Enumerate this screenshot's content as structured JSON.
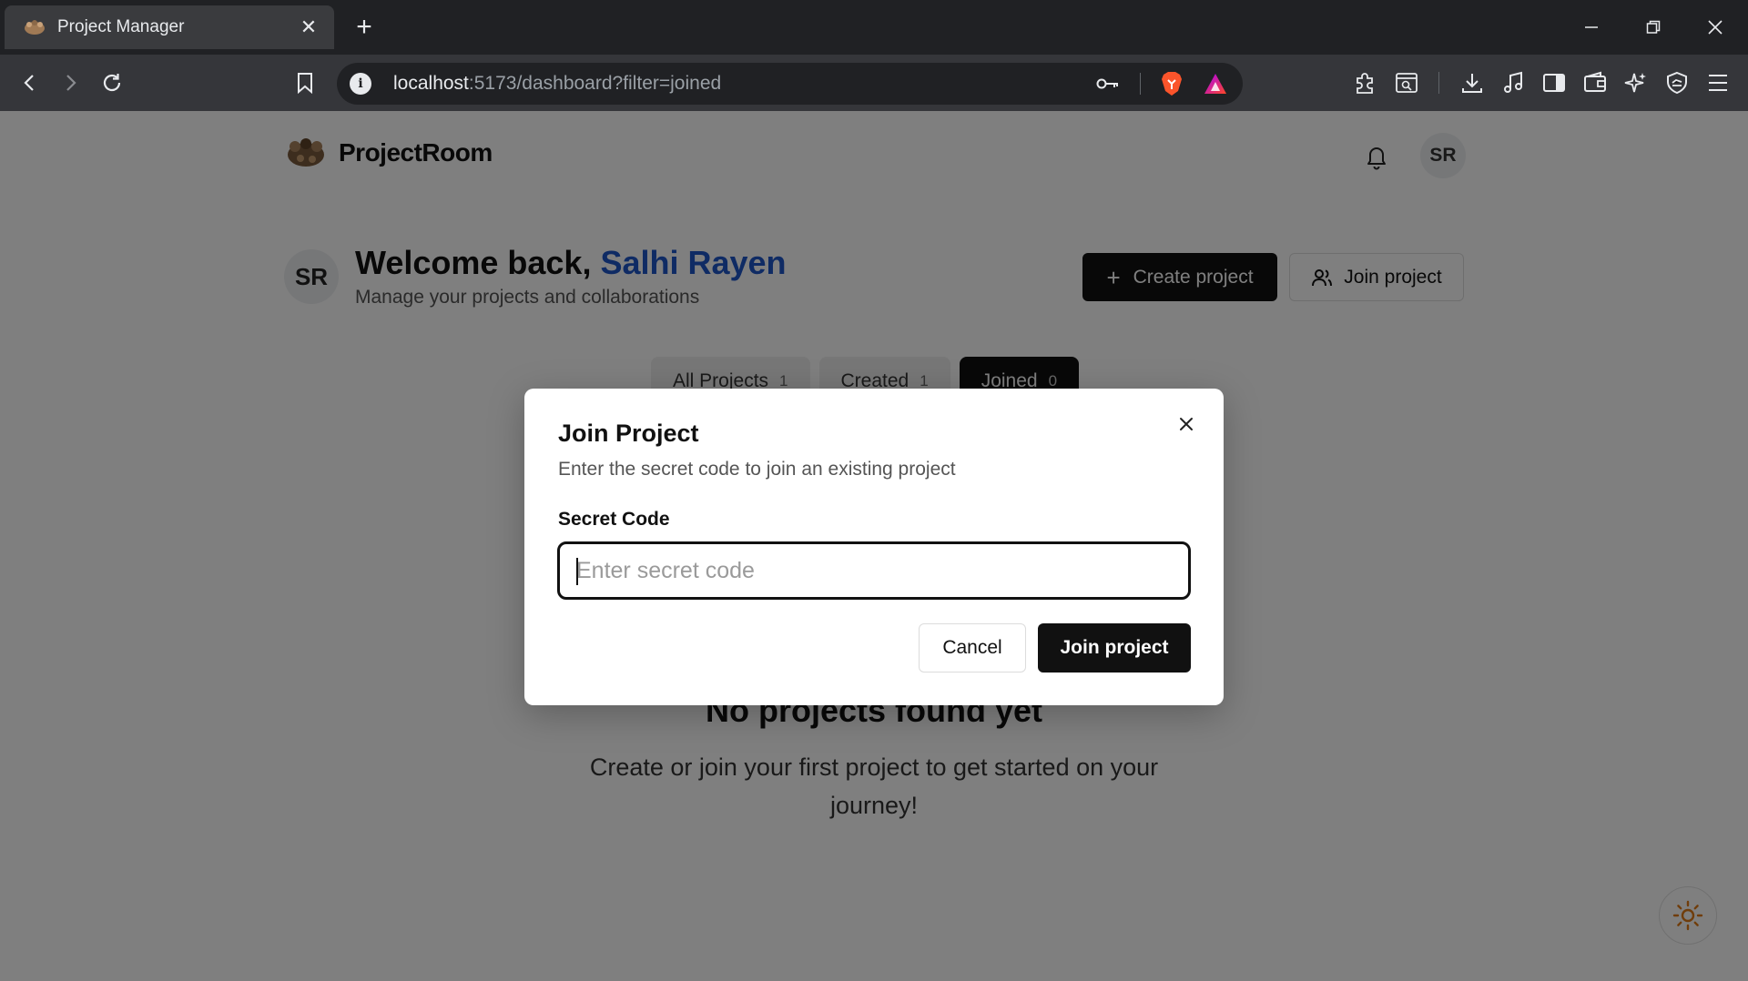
{
  "browser": {
    "tab": {
      "title": "Project Manager",
      "close_icon": "close-icon"
    },
    "new_tab_symbol": "+",
    "url": {
      "host": "localhost",
      "rest": ":5173/dashboard?filter=joined"
    },
    "window_controls": [
      "minimize-icon",
      "restore-icon",
      "close-icon"
    ]
  },
  "header": {
    "brand": "ProjectRoom",
    "avatar_initials": "SR"
  },
  "welcome": {
    "avatar_initials": "SR",
    "greeting": "Welcome back, ",
    "user_name": "Salhi Rayen",
    "subtitle": "Manage your projects and collaborations",
    "create_label": "Create project",
    "join_label": "Join project"
  },
  "filter_tabs": [
    {
      "label": "All Projects",
      "count": "1",
      "active": false
    },
    {
      "label": "Created",
      "count": "1",
      "active": false
    },
    {
      "label": "Joined",
      "count": "0",
      "active": true
    }
  ],
  "empty_state": {
    "title": "No projects found yet",
    "subtitle": "Create or join your first project to get started on your journey!"
  },
  "dialog": {
    "title": "Join Project",
    "description": "Enter the secret code to join an existing project",
    "field_label": "Secret Code",
    "field_value": "",
    "field_placeholder": "Enter secret code",
    "cancel_label": "Cancel",
    "submit_label": "Join project"
  },
  "colors": {
    "accent_name": "#1f56c9",
    "primary_button": "#111111",
    "brave_lion": "#fb542b",
    "theme_sun": "#e07b16"
  }
}
